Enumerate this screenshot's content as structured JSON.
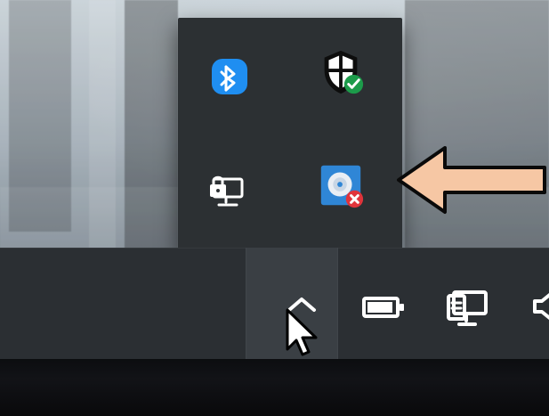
{
  "tray_flyout": {
    "items": [
      {
        "name": "bluetooth-icon"
      },
      {
        "name": "windows-security-icon"
      },
      {
        "name": "network-locked-icon"
      },
      {
        "name": "disc-error-icon"
      }
    ]
  },
  "taskbar": {
    "show_hidden_icons": {
      "name": "show-hidden-icons-chevron"
    },
    "icons": [
      {
        "name": "battery-icon"
      },
      {
        "name": "network-icon"
      },
      {
        "name": "speaker-icon"
      }
    ]
  },
  "annotation": {
    "arrow_color": "#f6c7a4",
    "arrow_outline": "#0a0a0a"
  },
  "colors": {
    "taskbar": "#2b2f33",
    "flyout": "#2c3033",
    "bluetooth_blue": "#1f8ef1",
    "defender_green": "#1c9b4a",
    "disc_bg": "#2f86d6",
    "error_red": "#e0343b"
  }
}
